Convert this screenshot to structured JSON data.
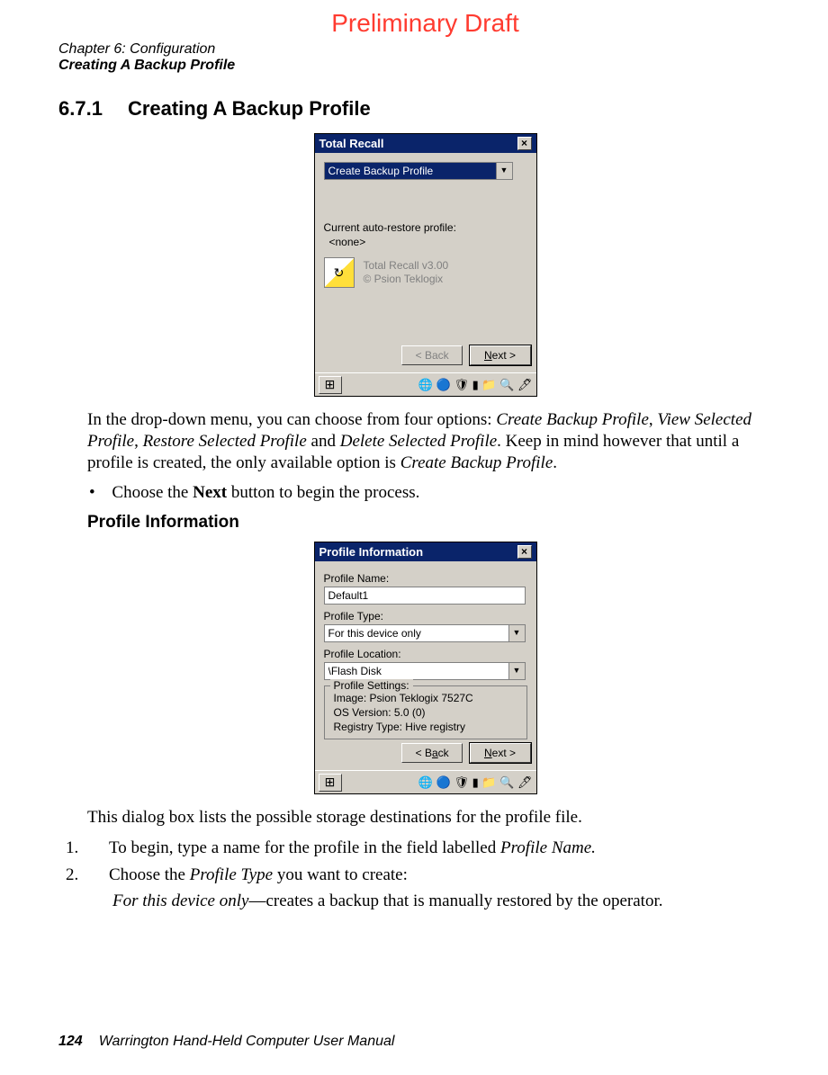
{
  "draft_header": "Preliminary Draft",
  "chapter_line": "Chapter 6:  Configuration",
  "chapter_sub": "Creating A Backup Profile",
  "section": {
    "number": "6.7.1",
    "title": "Creating A Backup Profile"
  },
  "dlg1": {
    "title": "Total Recall",
    "close": "×",
    "combo_value": "Create Backup Profile",
    "auto_label": "Current auto-restore profile:",
    "auto_value": "<none>",
    "about_line1": "Total Recall v3.00",
    "about_line2": "© Psion Teklogix",
    "back": "< Back",
    "next": "Next >",
    "start_icon": "⊞",
    "tray": "🌐 🔵 🛡 ▮ 📁 🔍 🖊"
  },
  "para1_a": "In the drop-down menu, you can choose from four options: ",
  "para1_opts": {
    "a": "Create Backup Profile",
    "b": "View Selected Profile",
    "c": "Restore Selected Profile",
    "d": "Delete Selected Profile"
  },
  "para1_mid1": ", ",
  "para1_mid2": ", ",
  "para1_mid3": " and ",
  "para1_b": ". Keep in mind however that until a profile is created, the only available option is ",
  "para1_c": ".",
  "bullet1_a": "Choose the ",
  "bullet1_bold": "Next",
  "bullet1_b": " button to begin the process.",
  "sub_heading": "Profile Information",
  "dlg2": {
    "title": "Profile Information",
    "close": "×",
    "name_label": "Profile Name:",
    "name_value": "Default1",
    "type_label": "Profile Type:",
    "type_value": "For this device only",
    "loc_label": "Profile Location:",
    "loc_value": "\\Flash Disk",
    "settings_label": "Profile Settings:",
    "s1": "Image: Psion Teklogix 7527C",
    "s2": "OS Version: 5.0 (0)",
    "s3": "Registry Type: Hive registry",
    "back": "< Back",
    "next": "Next >",
    "start_icon": "⊞",
    "tray": "🌐 🔵 🛡 ▮ 📁 🔍 🖊"
  },
  "para2": "This dialog box lists the possible storage destinations for the profile file.",
  "l1_a": "To begin, type a name for the profile in the field labelled ",
  "l1_i": "Profile Name.",
  "l2_a": "Choose the ",
  "l2_i": "Profile Type",
  "l2_b": " you want to create:",
  "l3_i": "For this device only",
  "l3_b": "—creates a backup that is manually restored by the operator.",
  "footer": {
    "page": "124",
    "title": "Warrington Hand-Held Computer User Manual"
  }
}
